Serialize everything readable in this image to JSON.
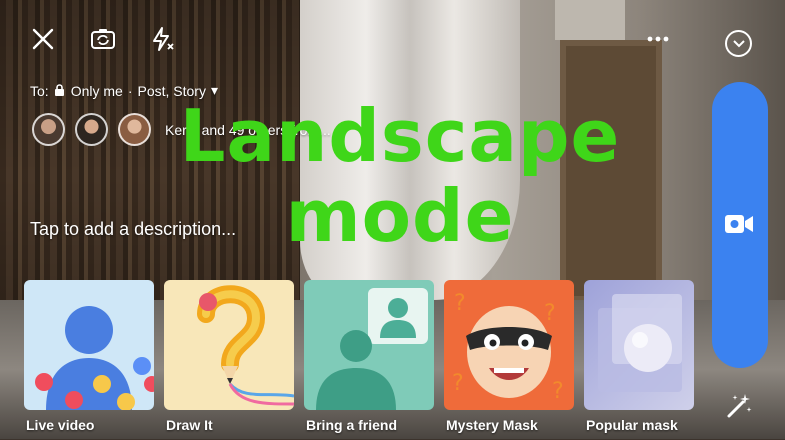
{
  "header": {
    "close_icon": "close-icon",
    "flip_icon": "camera-flip-icon",
    "flash_icon": "flash-off-icon",
    "more_icon": "more-icon",
    "done_icon": "chevron-down-circle-icon"
  },
  "audience": {
    "prefix": "To:",
    "privacy": "Only me",
    "separator": "·",
    "destination": "Post, Story",
    "caret": "▾"
  },
  "tags": {
    "text": "Kerin and 49 others from..."
  },
  "watermark": {
    "line1": "Landscape",
    "line2": "mode"
  },
  "composer": {
    "placeholder": "Tap to add a description..."
  },
  "effects": [
    {
      "label": "Live video"
    },
    {
      "label": "Draw It"
    },
    {
      "label": "Bring a friend"
    },
    {
      "label": "Mystery Mask"
    },
    {
      "label": "Popular mask"
    }
  ],
  "controls": {
    "record_icon": "video-camera-icon",
    "effects_icon": "magic-wand-icon"
  },
  "colors": {
    "accent": "#3b82f0",
    "watermark": "#3fd619"
  }
}
